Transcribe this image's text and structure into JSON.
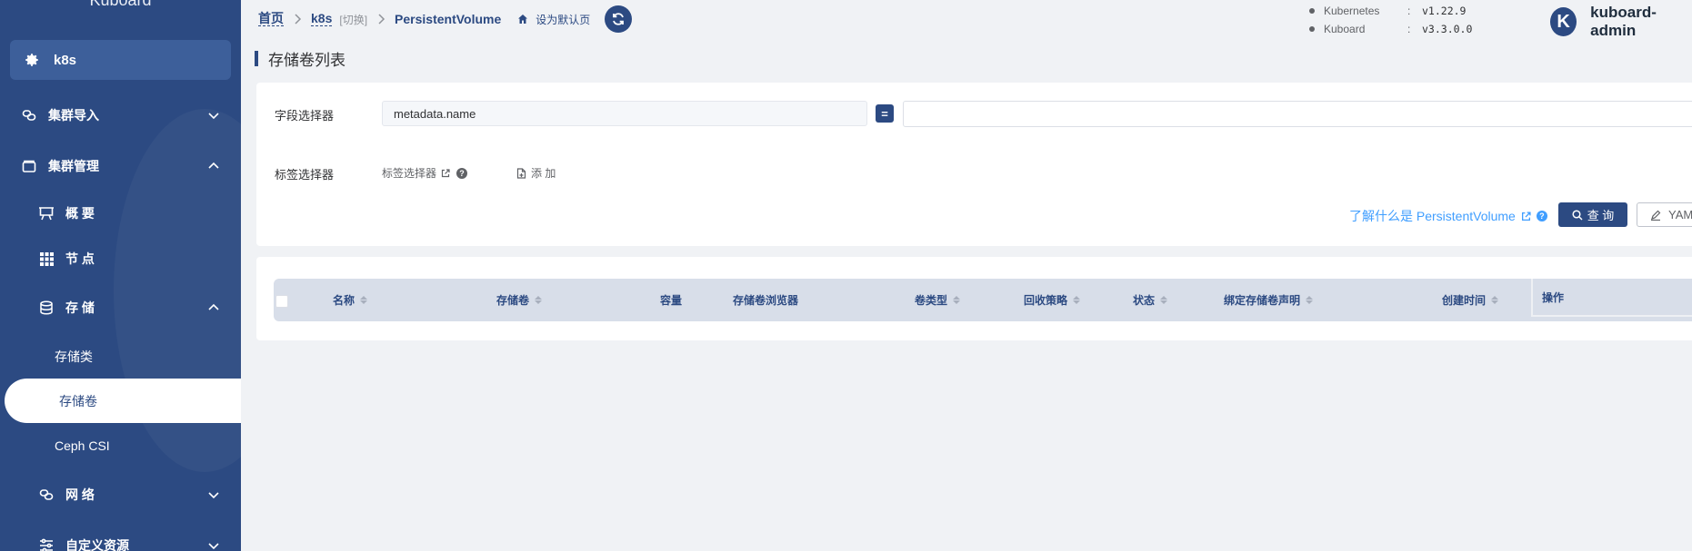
{
  "brand": "Kuboard",
  "sidebar": {
    "cluster": "k8s",
    "items": [
      {
        "label": "集群导入"
      },
      {
        "label": "集群管理"
      },
      {
        "label": "概 要"
      },
      {
        "label": "节 点"
      },
      {
        "label": "存 储"
      },
      {
        "label": "网 络"
      },
      {
        "label": "自定义资源"
      }
    ],
    "storage_children": [
      "存储类",
      "存储卷",
      "Ceph CSI"
    ],
    "active": "存储卷"
  },
  "breadcrumb": {
    "home": "首页",
    "cluster": "k8s",
    "switch": "[切换]",
    "current": "PersistentVolume",
    "set_default": "设为默认页"
  },
  "versions": [
    {
      "name": "Kubernetes",
      "sep": ":",
      "value": "v1.22.9"
    },
    {
      "name": "Kuboard",
      "sep": ":",
      "value": "v3.3.0.0"
    }
  ],
  "user": {
    "avatar_letter": "K",
    "name": "kuboard-admin"
  },
  "page_title": "存储卷列表",
  "filter": {
    "field_selector_label": "字段选择器",
    "field_selector_value": "metadata.name",
    "operator": "=",
    "value_placeholder": "",
    "label_selector_label": "标签选择器",
    "label_selector_link": "标签选择器",
    "add_label": "添 加",
    "learn_link": "了解什么是 PersistentVolume",
    "query_button": "查 询",
    "yaml_button": "YAML"
  },
  "table": {
    "columns": [
      "名称",
      "存储卷",
      "容量",
      "存储卷浏览器",
      "卷类型",
      "回收策略",
      "状态",
      "绑定存储卷声明",
      "创建时间",
      "操作"
    ]
  }
}
